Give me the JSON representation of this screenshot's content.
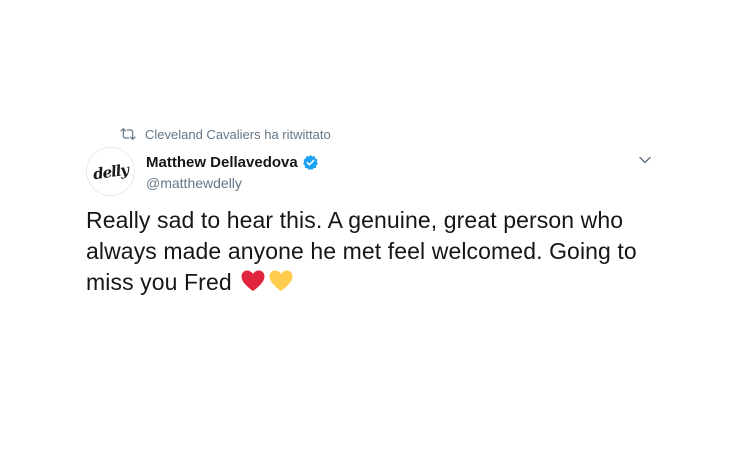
{
  "retweet_context": {
    "icon": "retweet-icon",
    "text": "Cleveland Cavaliers ha ritwittato"
  },
  "author": {
    "avatar_logo": "delly",
    "display_name": "Matthew Dellavedova",
    "verified": true,
    "handle": "@matthewdelly"
  },
  "tweet": {
    "text": "Really sad to hear this. A genuine, great person who always made anyone he met feel welcomed. Going to miss you Fred",
    "emojis": [
      "red-heart-icon",
      "yellow-heart-icon"
    ]
  },
  "menu": {
    "icon": "chevron-down-icon"
  },
  "colors": {
    "text_primary": "#14171a",
    "text_secondary": "#657786",
    "verified_blue": "#1da1f2",
    "heart_red": "#e0243b",
    "heart_yellow": "#ffcc4d",
    "background": "#ffffff"
  }
}
